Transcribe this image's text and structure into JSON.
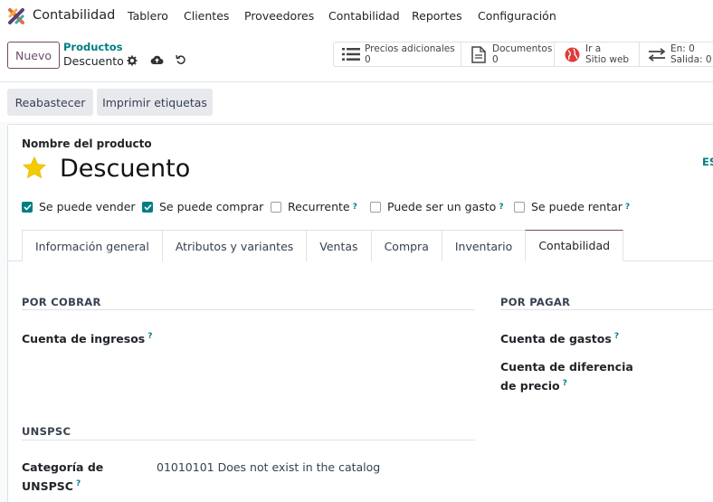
{
  "topbar": {
    "app_name": "Contabilidad",
    "menu": [
      "Tablero",
      "Clientes",
      "Proveedores",
      "Contabilidad",
      "Reportes",
      "Configuración"
    ]
  },
  "control_panel": {
    "new_label": "Nuevo",
    "breadcrumb_parent": "Productos",
    "breadcrumb_current": "Descuento",
    "stat_buttons": [
      {
        "icon": "list-icon",
        "line1": "Precios adicionales",
        "line2": "0"
      },
      {
        "icon": "document-icon",
        "line1": "Documentos",
        "line2": "0"
      },
      {
        "icon": "globe-icon",
        "line1": "Ir a",
        "line2": "Sitio web"
      },
      {
        "icon": "transfer-arrows-icon",
        "line1": "En: 0",
        "line2": "Salida: 0"
      }
    ]
  },
  "actions": {
    "replenish": "Reabastecer",
    "print_labels": "Imprimir etiquetas"
  },
  "form": {
    "name_label": "Nombre del producto",
    "product_name": "Descuento",
    "lang_badge": "ES",
    "checkboxes": [
      {
        "label": "Se puede vender",
        "checked": true,
        "help": ""
      },
      {
        "label": "Se puede comprar",
        "checked": true,
        "help": ""
      },
      {
        "label": "Recurrente",
        "checked": false,
        "help": "?"
      },
      {
        "label": "Puede ser un gasto",
        "checked": false,
        "help": "?"
      },
      {
        "label": "Se puede rentar",
        "checked": false,
        "help": "?"
      }
    ],
    "tabs": [
      "Información general",
      "Atributos y variantes",
      "Ventas",
      "Compra",
      "Inventario",
      "Contabilidad"
    ],
    "active_tab": "Contabilidad",
    "receivable": {
      "title": "POR COBRAR",
      "income_account_label": "Cuenta de ingresos",
      "help": "?"
    },
    "payable": {
      "title": "POR PAGAR",
      "expense_account_label": "Cuenta de gastos",
      "price_diff_label_1": "Cuenta de diferencia",
      "price_diff_label_2": "de precio",
      "help": "?"
    },
    "unspsc": {
      "title": "UNSPSC",
      "category_label_1": "Categoría de",
      "category_label_2": "UNSPSC",
      "category_value": "01010101 Does not exist in the catalog",
      "help": "?"
    }
  },
  "colors": {
    "primary": "#714b67",
    "accent": "#017e84",
    "star": "#f3cc00"
  }
}
